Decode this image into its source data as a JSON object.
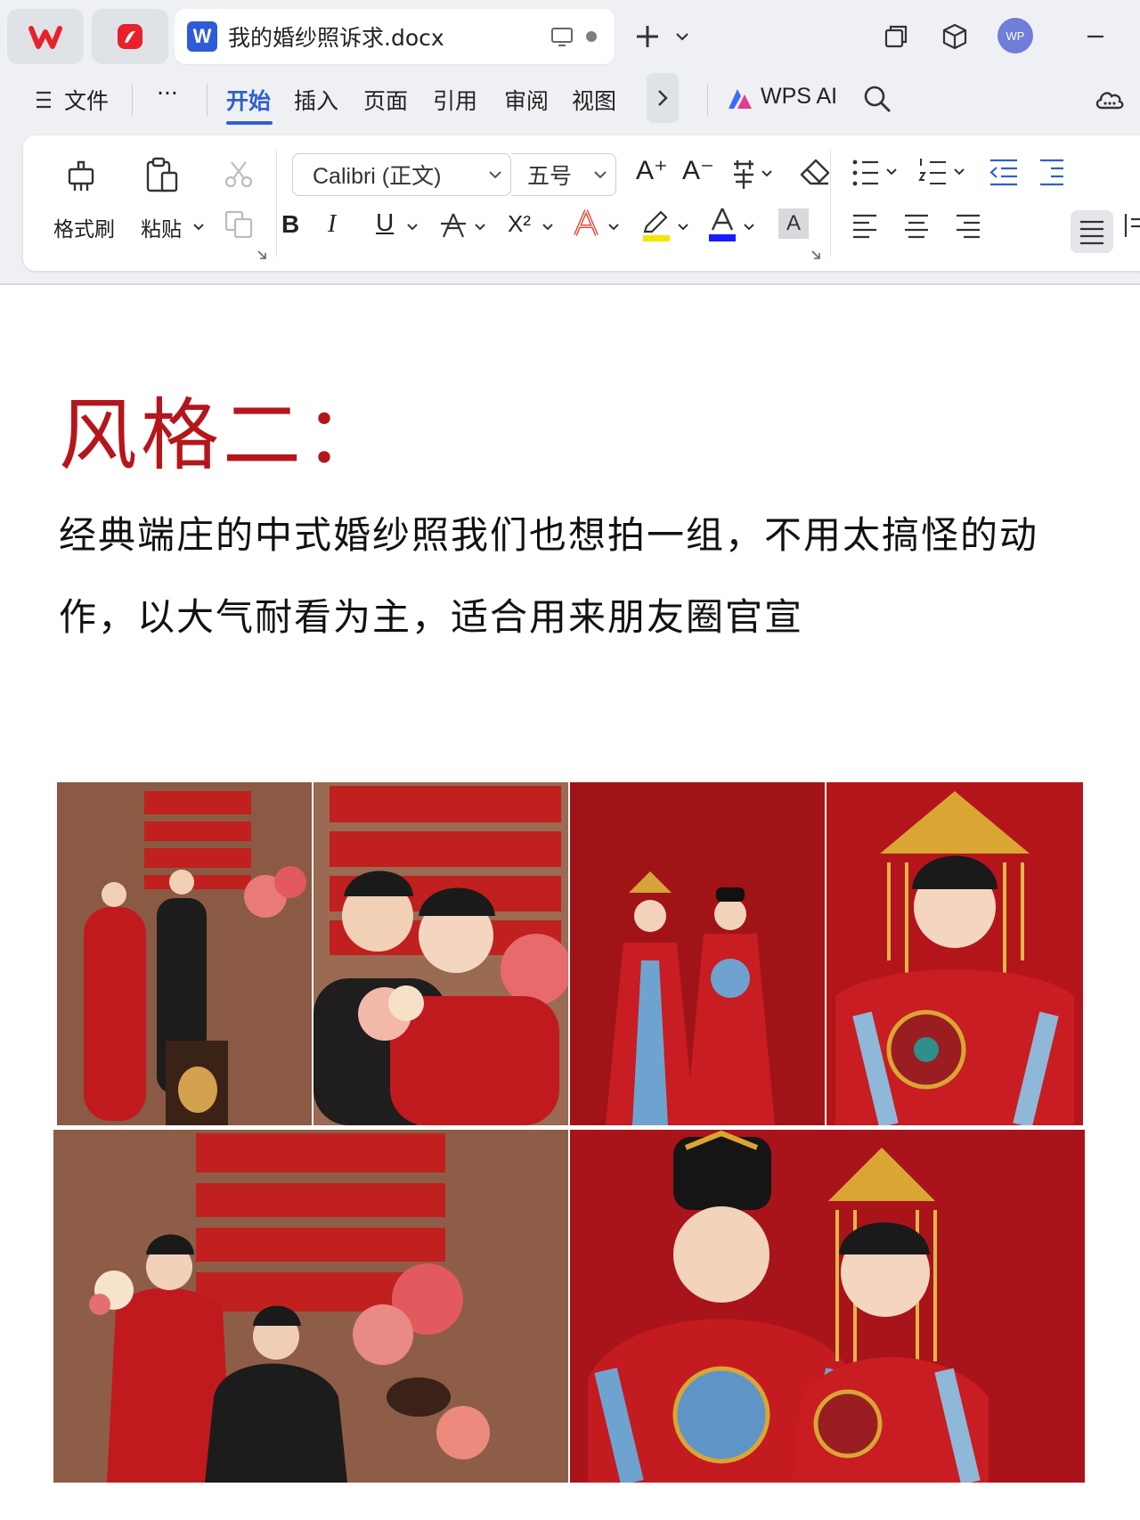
{
  "window": {
    "doc_tab_title": "我的婚纱照诉求.docx",
    "avatar_initials": "WP"
  },
  "menu": {
    "file_label": "文件",
    "more_label": "···",
    "tabs": [
      "开始",
      "插入",
      "页面",
      "引用",
      "审阅",
      "视图"
    ],
    "active_tab": "开始",
    "wps_ai_label": "WPS AI"
  },
  "ribbon": {
    "format_painter_label": "格式刷",
    "paste_label": "粘贴",
    "font_name": "Calibri (正文)",
    "font_size": "五号",
    "bold_glyph": "B",
    "italic_glyph": "I",
    "underline_glyph": "U",
    "superscript_glyph": "X²",
    "grow_font_glyph": "A⁺",
    "shrink_font_glyph": "A⁻",
    "char_shading_glyph": "A"
  },
  "colors": {
    "accent_blue": "#2f5fd0",
    "title_red": "#b5161c",
    "highlight_yellow": "#f5e500",
    "font_color_blue": "#1a1aff"
  },
  "document": {
    "heading": "风格二：",
    "paragraph": "经典端庄的中式婚纱照我们也想拍一组，不用太搞怪的动作，以大气耐看为主，适合用来朋友圈官宣"
  }
}
